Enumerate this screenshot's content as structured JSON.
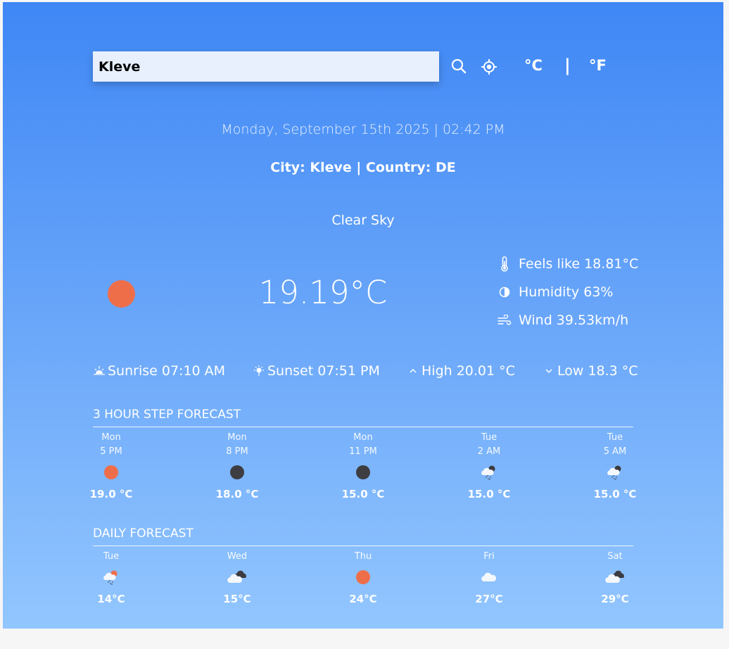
{
  "search": {
    "value": "Kleve"
  },
  "units": {
    "celsius_label": "°C",
    "separator": "|",
    "fahrenheit_label": "°F"
  },
  "datetime": "Monday, September 15th 2025 | 02:42 PM",
  "location": "City: Kleve | Country: DE",
  "current": {
    "description": "Clear Sky",
    "icon": "sun-icon",
    "temperature": "19.19°C",
    "feels_like": "Feels like 18.81°C",
    "humidity": "Humidity 63%",
    "wind": "Wind 39.53km/h",
    "sunrise": "Sunrise 07:10 AM",
    "sunset": "Sunset 07:51 PM",
    "high": "High 20.01 °C",
    "low": "Low 18.3 °C"
  },
  "hourly": {
    "title": "3 HOUR STEP FORECAST",
    "items": [
      {
        "day": "Mon",
        "time": "5 PM",
        "icon": "sun-icon",
        "temp": "19.0 °C"
      },
      {
        "day": "Mon",
        "time": "8 PM",
        "icon": "moon-icon",
        "temp": "18.0 °C"
      },
      {
        "day": "Mon",
        "time": "11 PM",
        "icon": "moon-icon",
        "temp": "15.0 °C"
      },
      {
        "day": "Tue",
        "time": "2 AM",
        "icon": "rain-cloud-moon-icon",
        "temp": "15.0 °C"
      },
      {
        "day": "Tue",
        "time": "5 AM",
        "icon": "rain-cloud-moon-icon",
        "temp": "15.0 °C"
      }
    ]
  },
  "daily": {
    "title": "DAILY FORECAST",
    "items": [
      {
        "day": "Tue",
        "icon": "rain-cloud-sun-icon",
        "temp": "14°C"
      },
      {
        "day": "Wed",
        "icon": "broken-clouds-icon",
        "temp": "15°C"
      },
      {
        "day": "Thu",
        "icon": "sun-icon",
        "temp": "24°C"
      },
      {
        "day": "Fri",
        "icon": "cloud-icon",
        "temp": "27°C"
      },
      {
        "day": "Sat",
        "icon": "broken-clouds-icon",
        "temp": "29°C"
      }
    ]
  },
  "colors": {
    "sun": "#ef6e4a",
    "moon": "#3d3d42",
    "cloud": "#f4f7fb",
    "dark_cloud": "#3b3b40",
    "rain": "#4a5a70"
  }
}
